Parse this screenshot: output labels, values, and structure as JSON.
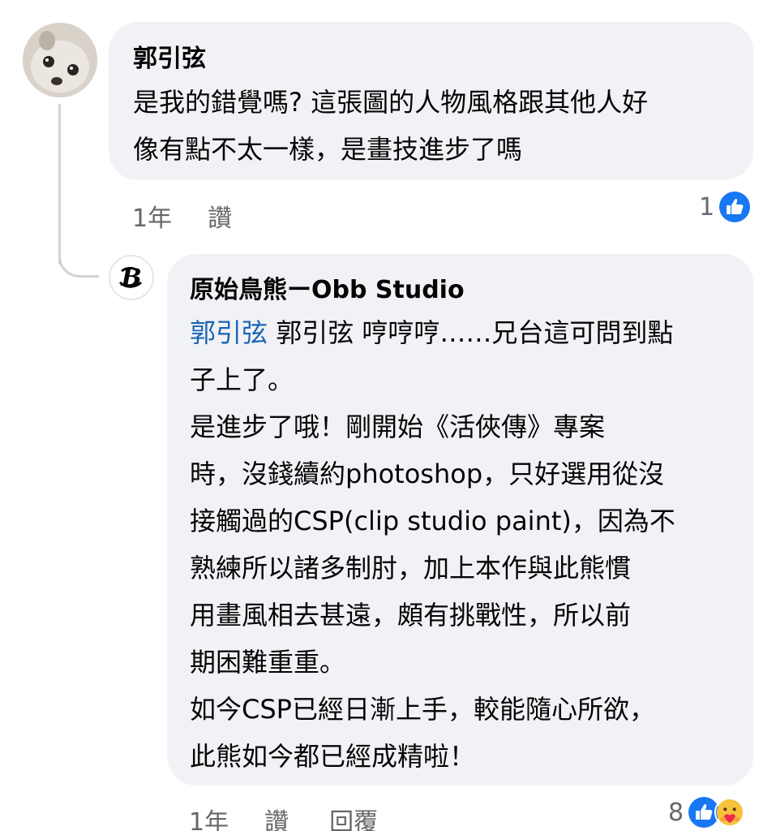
{
  "comment": {
    "author": "郭引弦",
    "lines": [
      "是我的錯覺嗎? 這張圖的人物風格跟其他人好",
      "像有點不太一樣，是畫技進步了嗎"
    ],
    "time": "1年",
    "like_label": "讚",
    "reaction_count": "1",
    "reaction_icon": "like-icon"
  },
  "reply": {
    "author": "原始鳥熊ーObb Studio",
    "mention": "郭引弦",
    "first_line_rest": " 郭引弦 哼哼哼……兄台這可問到點",
    "lines": [
      "子上了。",
      "是進步了哦！剛開始《活俠傳》專案",
      "時，沒錢續約photoshop，只好選用從沒",
      "接觸過的CSP(clip studio paint)，因為不",
      "熟練所以諸多制肘，加上本作與此熊慣",
      "用畫風相去甚遠，頗有挑戰性，所以前",
      "期困難重重。",
      "如今CSP已經日漸上手，較能隨心所欲，",
      "此熊如今都已經成精啦！"
    ],
    "time": "1年",
    "like_label": "讚",
    "reply_label": "回覆",
    "reaction_count": "8",
    "reaction_icons": [
      "like-icon",
      "care-icon"
    ]
  },
  "colors": {
    "bubble": "#f0f2f5",
    "mention": "#1b63b5",
    "like_blue": "#1877f2",
    "meta_gray": "#65676b"
  }
}
